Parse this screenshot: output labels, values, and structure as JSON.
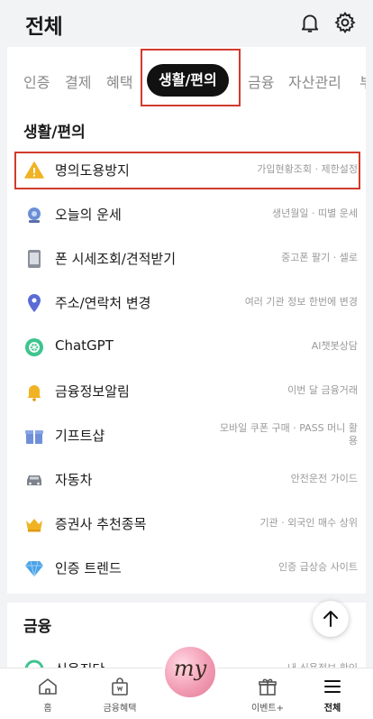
{
  "header": {
    "title": "전체"
  },
  "tabs": [
    {
      "label": "인증",
      "active": false
    },
    {
      "label": "결제",
      "active": false
    },
    {
      "label": "혜택",
      "active": false
    },
    {
      "label": "생활/편의",
      "active": true
    },
    {
      "label": "금융",
      "active": false
    },
    {
      "label": "자산관리",
      "active": false
    },
    {
      "label": "부",
      "active": false
    }
  ],
  "section_life": {
    "title": "생활/편의",
    "items": [
      {
        "label": "명의도용방지",
        "sub": "가입현황조회 · 제한설정",
        "icon": "warning-icon"
      },
      {
        "label": "오늘의 운세",
        "sub": "생년월일 · 띠별 운세",
        "icon": "fortune-icon"
      },
      {
        "label": "폰 시세조회/견적받기",
        "sub": "중고폰 팔기 · 셀로",
        "icon": "phone-icon"
      },
      {
        "label": "주소/연락처 변경",
        "sub": "여러 기관 정보 한번에 변경",
        "icon": "location-pin-icon"
      },
      {
        "label": "ChatGPT",
        "sub": "AI챗봇상담",
        "icon": "chatgpt-icon"
      },
      {
        "label": "금융정보알림",
        "sub": "이번 달 금융거래",
        "icon": "bell-icon"
      },
      {
        "label": "기프트샵",
        "sub": "모바일 쿠폰 구매 · PASS 머니 활용",
        "icon": "gift-icon"
      },
      {
        "label": "자동차",
        "sub": "안전운전 가이드",
        "icon": "car-icon"
      },
      {
        "label": "증권사 추천종목",
        "sub": "기관 · 외국인 매수 상위",
        "icon": "crown-icon"
      },
      {
        "label": "인증 트렌드",
        "sub": "인증 급상승 사이트",
        "icon": "diamond-icon"
      }
    ]
  },
  "section_finance": {
    "title": "금융",
    "items": [
      {
        "label": "신용진단",
        "sub": "내 신용정보 확인",
        "icon": "credit-icon"
      }
    ]
  },
  "bottom_nav": {
    "home": "홈",
    "finance_benefit": "금융혜택",
    "my": "my",
    "event": "이벤트+",
    "all": "전체"
  },
  "colors": {
    "highlight": "#d23a2d",
    "active_tab_bg": "#111111",
    "warning": "#f0b323",
    "pin": "#5b6bd6",
    "gpt": "#3ec48f",
    "diamond": "#4aa3e8"
  }
}
